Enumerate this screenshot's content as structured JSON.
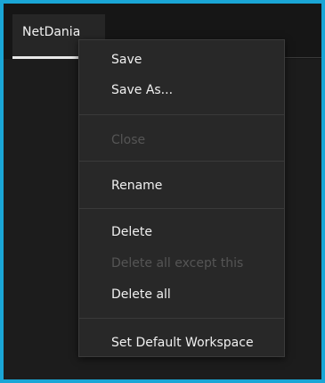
{
  "tab": {
    "label": "NetDania"
  },
  "menu": {
    "items": [
      {
        "label": "Save",
        "enabled": true
      },
      {
        "label": "Save As...",
        "enabled": true
      },
      {
        "label": "Close",
        "enabled": false
      },
      {
        "label": "Rename",
        "enabled": true
      },
      {
        "label": "Delete",
        "enabled": true
      },
      {
        "label": "Delete all except this",
        "enabled": false
      },
      {
        "label": "Delete all",
        "enabled": true
      },
      {
        "label": "Set Default Workspace",
        "enabled": true
      }
    ]
  },
  "colors": {
    "outer_border": "#1aa6d6",
    "background": "#161616",
    "menu_background": "#282828",
    "text": "#f0f0f0",
    "disabled_text": "#555555"
  }
}
